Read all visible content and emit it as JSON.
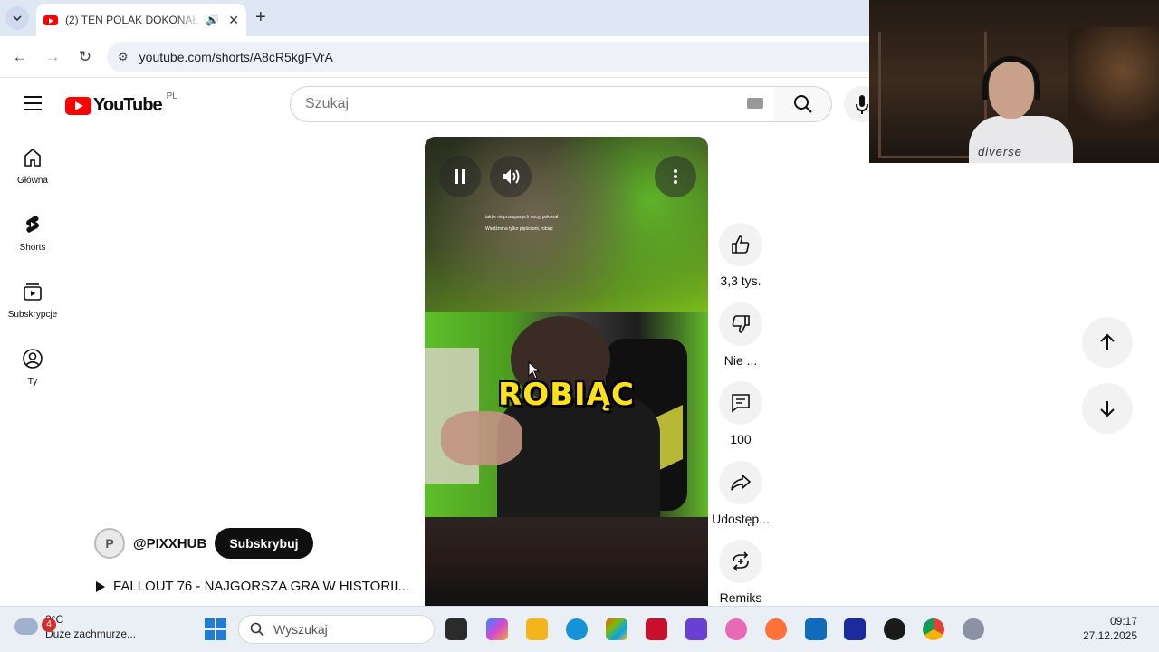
{
  "browser": {
    "tab_title": "(2) TEN POLAK DOKONAŁ N",
    "url": "youtube.com/shorts/A8cR5kgFVrA"
  },
  "youtube": {
    "logo_text": "YouTube",
    "country_code": "PL",
    "search_placeholder": "Szukaj",
    "guide": [
      {
        "label": "Główna",
        "icon": "home-icon"
      },
      {
        "label": "Shorts",
        "icon": "shorts-icon"
      },
      {
        "label": "Subskrypcje",
        "icon": "subscriptions-icon"
      },
      {
        "label": "Ty",
        "icon": "you-icon"
      }
    ],
    "video": {
      "subtitle_line1": "takže nieprzespanych nocy, pokonał",
      "subtitle_line2": "Wiedźmina tylko pięściami, robiąc",
      "caption": "ROBIĄC"
    },
    "actions": [
      {
        "label": "3,3 tys.",
        "icon": "like-icon"
      },
      {
        "label": "Nie ...",
        "icon": "dislike-icon"
      },
      {
        "label": "100",
        "icon": "comments-icon"
      },
      {
        "label": "Udostęp...",
        "icon": "share-icon"
      },
      {
        "label": "Remiks",
        "icon": "remix-icon"
      }
    ],
    "channel": {
      "handle": "@PIXXHUB",
      "subscribe_label": "Subskrybuj"
    },
    "video_title": "FALLOUT  76 - NAJGORSZA GRA W HISTORII..."
  },
  "webcam": {
    "shirt_text": "diverse"
  },
  "taskbar": {
    "weather_badge": "4",
    "temperature": "2°C",
    "weather_desc": "Duże zachmurze...",
    "search_placeholder": "Wyszukaj",
    "time": "09:17",
    "date": "27.12.2025"
  }
}
